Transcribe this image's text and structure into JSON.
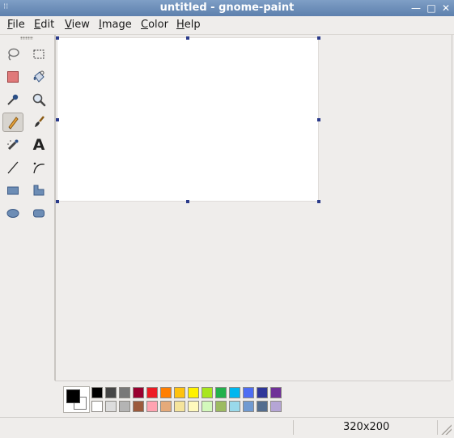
{
  "window": {
    "title": "untitled - gnome-paint",
    "sysmenu_glyph": "⁝⁝",
    "minimize_glyph": "—",
    "maximize_glyph": "□",
    "close_glyph": "✕"
  },
  "menu": [
    "File",
    "Edit",
    "View",
    "Image",
    "Color",
    "Help"
  ],
  "tools": [
    {
      "name": "lasso-select-icon",
      "active": false
    },
    {
      "name": "rect-select-icon",
      "active": false
    },
    {
      "name": "eraser-icon",
      "active": false
    },
    {
      "name": "fill-bucket-icon",
      "active": false
    },
    {
      "name": "color-picker-icon",
      "active": false
    },
    {
      "name": "zoom-icon",
      "active": false
    },
    {
      "name": "pencil-icon",
      "active": true
    },
    {
      "name": "paintbrush-icon",
      "active": false
    },
    {
      "name": "airbrush-icon",
      "active": false
    },
    {
      "name": "text-icon",
      "active": false
    },
    {
      "name": "line-icon",
      "active": false
    },
    {
      "name": "curve-icon",
      "active": false
    },
    {
      "name": "rectangle-icon",
      "active": false
    },
    {
      "name": "polygon-icon",
      "active": false
    },
    {
      "name": "ellipse-icon",
      "active": false
    },
    {
      "name": "rounded-rect-icon",
      "active": false
    }
  ],
  "text_tool_glyph": "A",
  "palette": {
    "foreground": "#000000",
    "background": "#ffffff",
    "row1": [
      "#000000",
      "#464646",
      "#787878",
      "#990030",
      "#ed1c24",
      "#ff7e00",
      "#ffc20e",
      "#fff200",
      "#a8e61d",
      "#22b14c",
      "#00b7ef",
      "#4d6df3",
      "#2f3699",
      "#6f3198"
    ],
    "row2": [
      "#ffffff",
      "#dcdcdc",
      "#b4b4b4",
      "#9c5a3c",
      "#ffa3b1",
      "#e5aa7a",
      "#f5e49c",
      "#fff9bd",
      "#d3f9bc",
      "#9dbb61",
      "#99d9ea",
      "#709ad1",
      "#546d8e",
      "#b5a5d5"
    ]
  },
  "status": {
    "size": "320x200"
  }
}
